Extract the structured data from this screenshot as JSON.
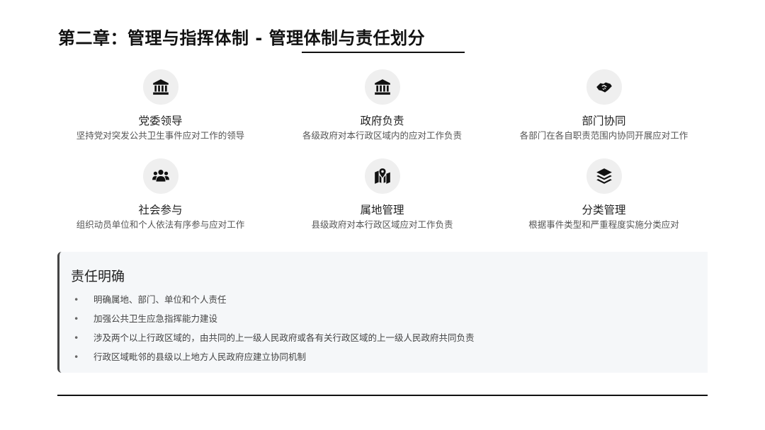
{
  "page": {
    "title": "第二章：管理与指挥体制 - 管理体制与责任划分"
  },
  "cards": [
    {
      "icon": "institution-icon",
      "title": "党委领导",
      "desc": "坚持党对突发公共卫生事件应对工作的领导"
    },
    {
      "icon": "institution-icon",
      "title": "政府负责",
      "desc": "各级政府对本行政区域内的应对工作负责"
    },
    {
      "icon": "handshake-icon",
      "title": "部门协同",
      "desc": "各部门在各自职责范围内协同开展应对工作"
    },
    {
      "icon": "users-icon",
      "title": "社会参与",
      "desc": "组织动员单位和个人依法有序参与应对工作"
    },
    {
      "icon": "map-location-icon",
      "title": "属地管理",
      "desc": "县级政府对本行政区域应对工作负责"
    },
    {
      "icon": "layers-icon",
      "title": "分类管理",
      "desc": "根据事件类型和严重程度实施分类应对"
    }
  ],
  "responsibility": {
    "title": "责任明确",
    "bullet": "•",
    "items": [
      "明确属地、部门、单位和个人责任",
      "加强公共卫生应急指挥能力建设",
      "涉及两个以上行政区域的，由共同的上一级人民政府或各有关行政区域的上一级人民政府共同负责",
      "行政区域毗邻的县级以上地方人民政府应建立协同机制"
    ]
  },
  "colors": {
    "icon_bg": "#efefef",
    "panel_bg": "#f5f7f9",
    "accent_line": "#111111"
  }
}
